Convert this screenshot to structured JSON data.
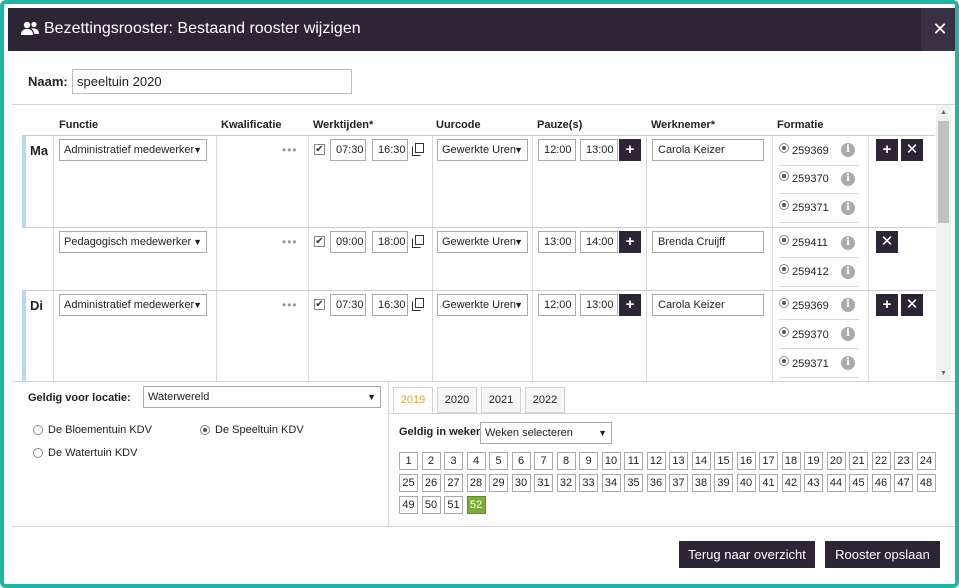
{
  "dialog": {
    "title": "Bezettingsrooster: Bestaand rooster wijzigen",
    "close_symbol": "✕",
    "title_icon": "people-icon"
  },
  "name": {
    "label": "Naam:",
    "value": "speeltuin 2020"
  },
  "columns": {
    "functie": "Functie",
    "kwalificatie": "Kwalificatie",
    "werktijden": "Werktijden*",
    "uurcode": "Uurcode",
    "pauze": "Pauze(s)",
    "werknemer": "Werknemer*",
    "formatie": "Formatie"
  },
  "rows": [
    {
      "day": "Ma",
      "functie": "Administratief medewerker",
      "checked": true,
      "start": "07:30",
      "end": "16:30",
      "uurcode": "Gewerkte Uren",
      "pause_start": "12:00",
      "pause_end": "13:00",
      "werknemer": "Carola Keizer",
      "formatie": [
        "259369",
        "259370",
        "259371"
      ]
    },
    {
      "day": "",
      "functie": "Pedagogisch medewerker",
      "checked": true,
      "start": "09:00",
      "end": "18:00",
      "uurcode": "Gewerkte Uren",
      "pause_start": "13:00",
      "pause_end": "14:00",
      "werknemer": "Brenda Cruijff",
      "formatie": [
        "259411",
        "259412"
      ]
    },
    {
      "day": "Di",
      "functie": "Administratief medewerker",
      "checked": true,
      "start": "07:30",
      "end": "16:30",
      "uurcode": "Gewerkte Uren",
      "pause_start": "12:00",
      "pause_end": "13:00",
      "werknemer": "Carola Keizer",
      "formatie": [
        "259369",
        "259370",
        "259371"
      ]
    }
  ],
  "location": {
    "label": "Geldig voor locatie:",
    "selected": "Waterwereld",
    "options": [
      {
        "label": "De Bloementuin KDV",
        "selected": false
      },
      {
        "label": "De Speeltuin KDV",
        "selected": true
      },
      {
        "label": "De Watertuin KDV",
        "selected": false
      }
    ]
  },
  "years": {
    "tabs": [
      "2019",
      "2020",
      "2021",
      "2022"
    ],
    "active": "2019",
    "weeks_label": "Geldig in weken:",
    "weeks_placeholder": "Weken selecteren",
    "weeks": [
      "1",
      "2",
      "3",
      "4",
      "5",
      "6",
      "7",
      "8",
      "9",
      "10",
      "11",
      "12",
      "13",
      "14",
      "15",
      "16",
      "17",
      "18",
      "19",
      "20",
      "21",
      "22",
      "23",
      "24",
      "25",
      "26",
      "27",
      "28",
      "29",
      "30",
      "31",
      "32",
      "33",
      "34",
      "35",
      "36",
      "37",
      "38",
      "39",
      "40",
      "41",
      "42",
      "43",
      "44",
      "45",
      "46",
      "47",
      "48",
      "49",
      "50",
      "51",
      "52"
    ],
    "selected_weeks": [
      "52"
    ]
  },
  "footer": {
    "back_label": "Terug naar overzicht",
    "save_label": "Rooster opslaan"
  },
  "colors": {
    "titlebar": "#2d2436",
    "frame": "#1fb6a3",
    "day_marker": "#b5d8f2",
    "active_tab": "#e8a23a",
    "selected_week": "#7aad3a"
  }
}
